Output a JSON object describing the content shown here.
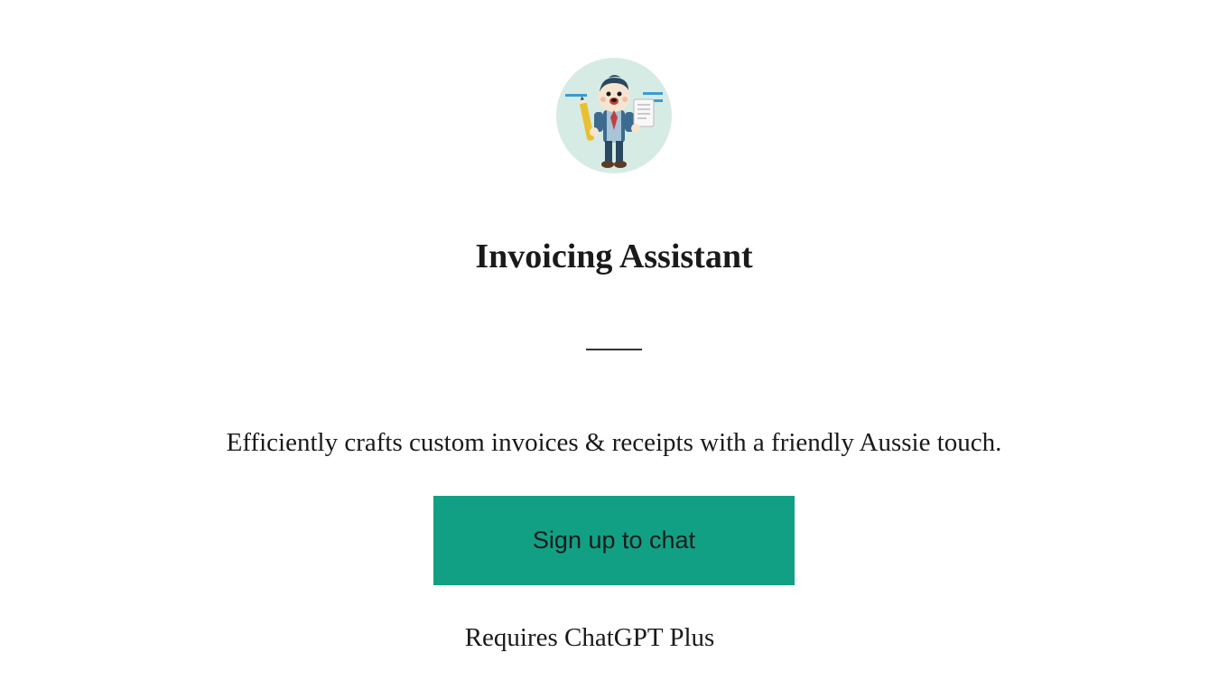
{
  "title": "Invoicing Assistant",
  "description": "Efficiently crafts custom invoices & receipts with a friendly Aussie touch.",
  "signup_label": "Sign up to chat",
  "requires_text": "Requires ChatGPT Plus"
}
